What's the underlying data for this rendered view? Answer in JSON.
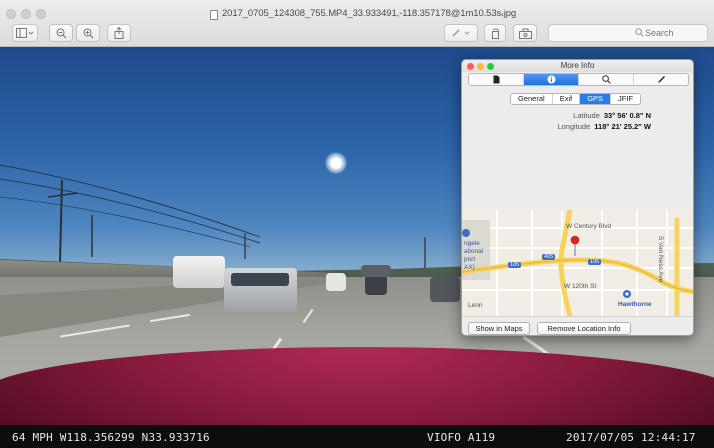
{
  "window": {
    "title": "2017_0705_124308_755.MP4_33.933491,-118.357178@1m10.53s.jpg",
    "search_placeholder": "Search"
  },
  "toolbar": {
    "icons": [
      "sidebar-icon",
      "zoom-out-icon",
      "zoom-in-icon",
      "share-icon",
      "markup-pen-icon",
      "rotate-icon",
      "toolbox-icon"
    ]
  },
  "overlay": {
    "speed_position": "64 MPH W118.356299 N33.933716",
    "camera": "VIOFO A119",
    "datetime": "2017/07/05 12:44:17"
  },
  "panel": {
    "title": "More Info",
    "tabs": [
      "document-icon",
      "info-icon",
      "search-icon",
      "pen-icon"
    ],
    "active_tab": 1,
    "subtabs": [
      "General",
      "Exif",
      "GPS",
      "JFIF"
    ],
    "active_subtab": 2,
    "latitude_label": "Latitude",
    "latitude_value": "33° 56' 0.8\" N",
    "longitude_label": "Longitude",
    "longitude_value": "118° 21' 25.2\" W",
    "show_in_maps": "Show in Maps",
    "remove_location": "Remove Location Info"
  },
  "map": {
    "labels": {
      "century": "W Century Blvd",
      "w120": "W 120th St",
      "hawthorne": "Hawthorne",
      "inglewood_1": "ngele",
      "inglewood_2": "ational",
      "inglewood_3": "port",
      "inglewood_4": "AX)",
      "lennox": "Lenn",
      "vanness": "S Van Ness Ave",
      "shield_a": "105",
      "shield_b": "405",
      "shield_c": "105"
    },
    "colors": {
      "freeway": "#f7d25c",
      "road": "#ffffff",
      "shield": "#3a6fc4",
      "pin": "#e02424"
    }
  },
  "colors": {
    "hood": "#8a1b3f",
    "accent_blue": "#1f6fe0"
  }
}
